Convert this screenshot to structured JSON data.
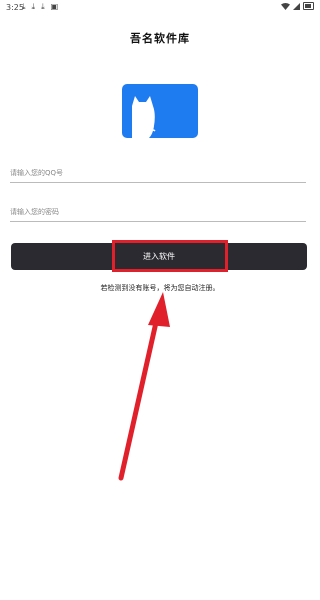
{
  "status_bar": {
    "time": "3:25",
    "notification_icons": [
      "download-icon",
      "download-icon",
      "download-icon",
      "image-icon"
    ],
    "right_icons": [
      "wifi-icon",
      "signal-icon",
      "battery-icon"
    ]
  },
  "page": {
    "title": "吾名软件库"
  },
  "form": {
    "qq_placeholder": "请输入您的QQ号",
    "password_placeholder": "请输入您的密码",
    "login_label": "进入软件",
    "hint": "若检测到没有账号，将为您自动注册。"
  },
  "colors": {
    "logo_blue": "#1f7bf0",
    "button_dark": "#2b2a30",
    "annotation_red": "#e0212b"
  }
}
